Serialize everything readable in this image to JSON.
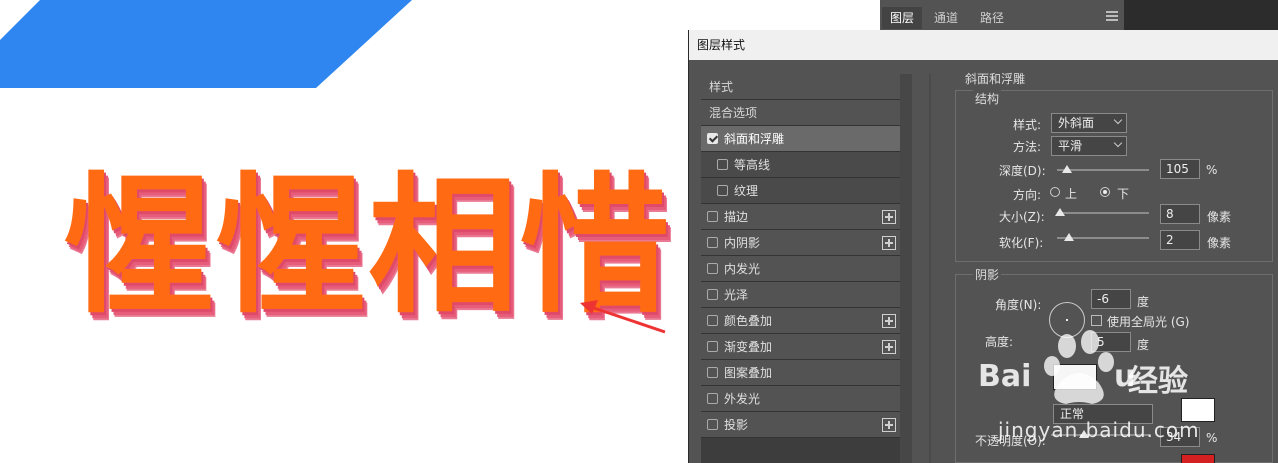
{
  "canvas": {
    "art_text": "惺惺相惜",
    "text_color": "#ff6a13",
    "shadow_color": "#e65c7a",
    "accent_blue": "#2f86f0"
  },
  "layers_panel": {
    "tabs": [
      "图层",
      "通道",
      "路径"
    ]
  },
  "dialog": {
    "title": "图层样式",
    "styles_list": {
      "items": [
        {
          "label": "样式",
          "type": "header"
        },
        {
          "label": "混合选项",
          "type": "header"
        },
        {
          "label": "斜面和浮雕",
          "checked": true,
          "selected": true
        },
        {
          "label": "等高线",
          "checked": false,
          "sub": true
        },
        {
          "label": "纹理",
          "checked": false,
          "sub": true
        },
        {
          "label": "描边",
          "checked": false,
          "plus": true
        },
        {
          "label": "内阴影",
          "checked": false,
          "plus": true
        },
        {
          "label": "内发光",
          "checked": false
        },
        {
          "label": "光泽",
          "checked": false
        },
        {
          "label": "颜色叠加",
          "checked": false,
          "plus": true
        },
        {
          "label": "渐变叠加",
          "checked": false,
          "plus": true
        },
        {
          "label": "图案叠加",
          "checked": false
        },
        {
          "label": "外发光",
          "checked": false
        },
        {
          "label": "投影",
          "checked": false,
          "plus": true
        }
      ]
    },
    "bevel": {
      "section_title": "斜面和浮雕",
      "structure_title": "结构",
      "style_label": "样式:",
      "style_value": "外斜面",
      "technique_label": "方法:",
      "technique_value": "平滑",
      "depth_label": "深度(D):",
      "depth_value": "105",
      "depth_unit": "%",
      "depth_fraction": 0.105,
      "direction_label": "方向:",
      "dir_up": "上",
      "dir_down": "下",
      "direction_selected": "下",
      "size_label": "大小(Z):",
      "size_value": "8",
      "size_unit": "像素",
      "size_fraction": 0.033,
      "soften_label": "软化(F):",
      "soften_value": "2",
      "soften_unit": "像素",
      "soften_fraction": 0.125
    },
    "shading": {
      "title": "阴影",
      "angle_label": "角度(N):",
      "angle_value": "-6",
      "angle_unit": "度",
      "global_light_label": "使用全局光 (G)",
      "global_light_checked": false,
      "altitude_label": "高度:",
      "altitude_value": "5",
      "altitude_unit": "度",
      "highlight_mode_value": "正常",
      "highlight_color": "#ffffff",
      "opacity_label": "不透明度(O):",
      "opacity_value": "34",
      "opacity_unit": "%",
      "opacity_fraction": 0.34,
      "shadow_color": "#d42020"
    }
  },
  "watermark": {
    "brand": "Baidu",
    "sub": "经验",
    "url": "jingyan.baidu.com"
  }
}
